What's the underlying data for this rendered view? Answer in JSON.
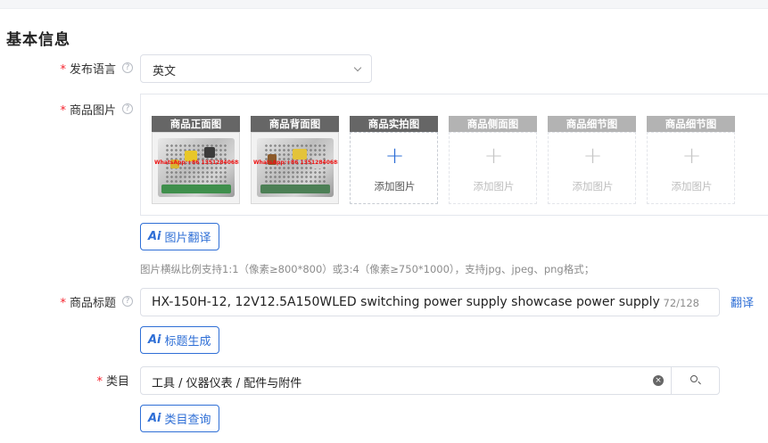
{
  "section": {
    "title": "基本信息"
  },
  "language": {
    "label": "发布语言",
    "value": "英文"
  },
  "images": {
    "label": "商品图片",
    "slots": [
      {
        "title": "商品正面图",
        "filled": true
      },
      {
        "title": "商品背面图",
        "filled": true
      },
      {
        "title": "商品实拍图",
        "filled": false,
        "add_text": "添加图片",
        "active": true
      },
      {
        "title": "商品侧面图",
        "filled": false,
        "add_text": "添加图片",
        "active": false
      },
      {
        "title": "商品细节图",
        "filled": false,
        "add_text": "添加图片",
        "active": false
      },
      {
        "title": "商品细节图",
        "filled": false,
        "add_text": "添加图片",
        "active": false
      }
    ],
    "watermark_text": "WhatsApp:+86 13512840688",
    "translate_button": "图片翻译",
    "hint": "图片横纵比例支持1:1（像素≥800*800）或3:4（像素≥750*1000），支持jpg、jpeg、png格式；"
  },
  "product_title": {
    "label": "商品标题",
    "value": "HX-150H-12, 12V12.5A150WLED switching power supply showcase power supply",
    "count": "72/128",
    "translate_link": "翻译",
    "generate_button": "标题生成"
  },
  "category": {
    "label": "类目",
    "value": "工具 / 仪器仪表 / 配件与附件",
    "query_button": "类目查询"
  },
  "icons": {
    "ai": "Ai",
    "help": "?",
    "plus": "+",
    "clear": "×"
  },
  "colors": {
    "accent": "#2f6fd6",
    "required": "#f5222d",
    "slot_header_active": "#666666",
    "slot_header_disabled": "#b3b3b3",
    "hint": "#8c8c8c"
  }
}
